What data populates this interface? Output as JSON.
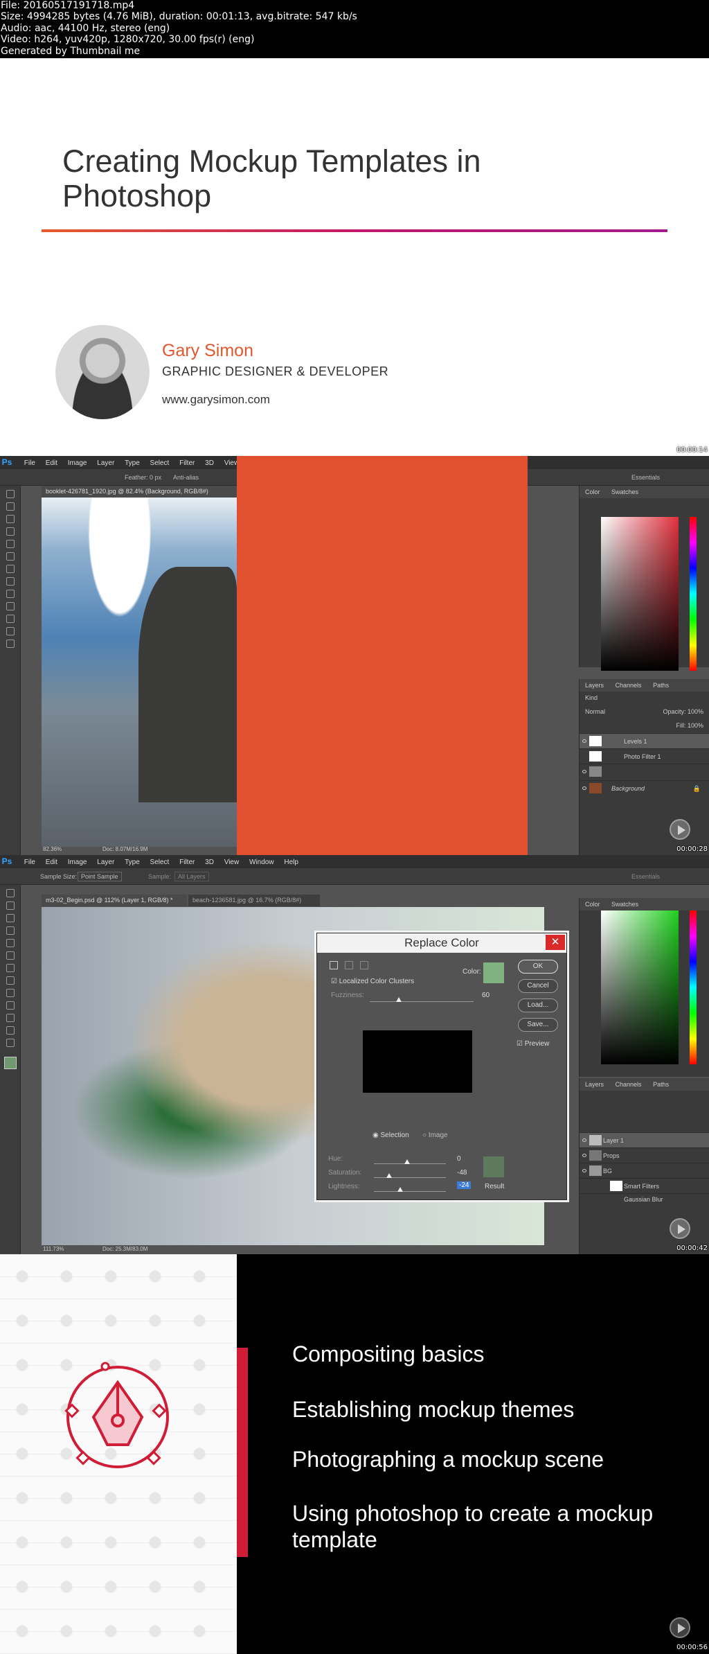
{
  "meta": [
    "File: 20160517191718.mp4",
    "Size: 4994285 bytes (4.76 MiB), duration: 00:01:13, avg.bitrate: 547 kb/s",
    "Audio: aac, 44100 Hz, stereo (eng)",
    "Video: h264, yuv420p, 1280x720, 30.00 fps(r) (eng)",
    "Generated by Thumbnail me"
  ],
  "frame1": {
    "title": "Creating Mockup Templates in Photoshop",
    "author": "Gary Simon",
    "role": "GRAPHIC DESIGNER & DEVELOPER",
    "site": "www.garysimon.com",
    "timestamp": "00:00:14"
  },
  "ps_menu": [
    "File",
    "Edit",
    "Image",
    "Layer",
    "Type",
    "Select",
    "Filter",
    "3D",
    "View",
    "Window",
    "Help"
  ],
  "frame2": {
    "doc_tab": "booklet-426781_1920.jpg @ 82.4% (Background, RGB/8#)",
    "opt_feather": "Feather: 0 px",
    "opt_antialias": "Anti-alias",
    "workspace": "Essentials",
    "zoom": "82.36%",
    "doc_info": "Doc: 8.07M/16.9M",
    "panel_color_tabs": [
      "Color",
      "Swatches"
    ],
    "panel_layer_tabs": [
      "Layers",
      "Channels",
      "Paths"
    ],
    "blend_mode": "Normal",
    "opacity": "Opacity: 100%",
    "fill": "Fill: 100%",
    "kind": "Kind",
    "layers": [
      "Levels 1",
      "Photo Filter 1",
      "Background"
    ],
    "timestamp": "00:00:28"
  },
  "frame3": {
    "opt_sample_size_label": "Sample Size:",
    "opt_sample_size": "Point Sample",
    "opt_sample": "Sample:",
    "opt_sample_val": "All Layers",
    "workspace": "Essentials",
    "doc_tab1": "m3-02_Begin.psd @ 112% (Layer 1, RGB/8) *",
    "doc_tab2": "beach-1236581.jpg @ 16.7% (RGB/8#)",
    "zoom": "111.73%",
    "doc_info": "Doc: 25.3M/83.0M",
    "dialog": {
      "title": "Replace Color",
      "localized": "Localized Color Clusters",
      "color_label": "Color:",
      "fuzziness_label": "Fuzziness:",
      "fuzziness": "60",
      "ok": "OK",
      "cancel": "Cancel",
      "load": "Load...",
      "save": "Save...",
      "preview": "Preview",
      "selection": "Selection",
      "image": "Image",
      "hue_label": "Hue:",
      "hue": "0",
      "saturation_label": "Saturation:",
      "saturation": "-48",
      "lightness_label": "Lightness:",
      "lightness": "-24",
      "result": "Result",
      "sample_color": "#7fb27f",
      "result_color": "#5e7a5e"
    },
    "panel_color_tabs": [
      "Color",
      "Swatches"
    ],
    "panel_layer_tabs": [
      "Layers",
      "Channels",
      "Paths"
    ],
    "layers": [
      "Layer 1",
      "Props",
      "BG",
      "Smart Filters",
      "Gaussian Blur"
    ],
    "timestamp": "00:00:42"
  },
  "frame4": {
    "topics": [
      "Compositing basics",
      "Establishing mockup themes",
      "Photographing a mockup scene",
      "Using photoshop to create a mockup template"
    ],
    "timestamp": "00:00:56"
  }
}
